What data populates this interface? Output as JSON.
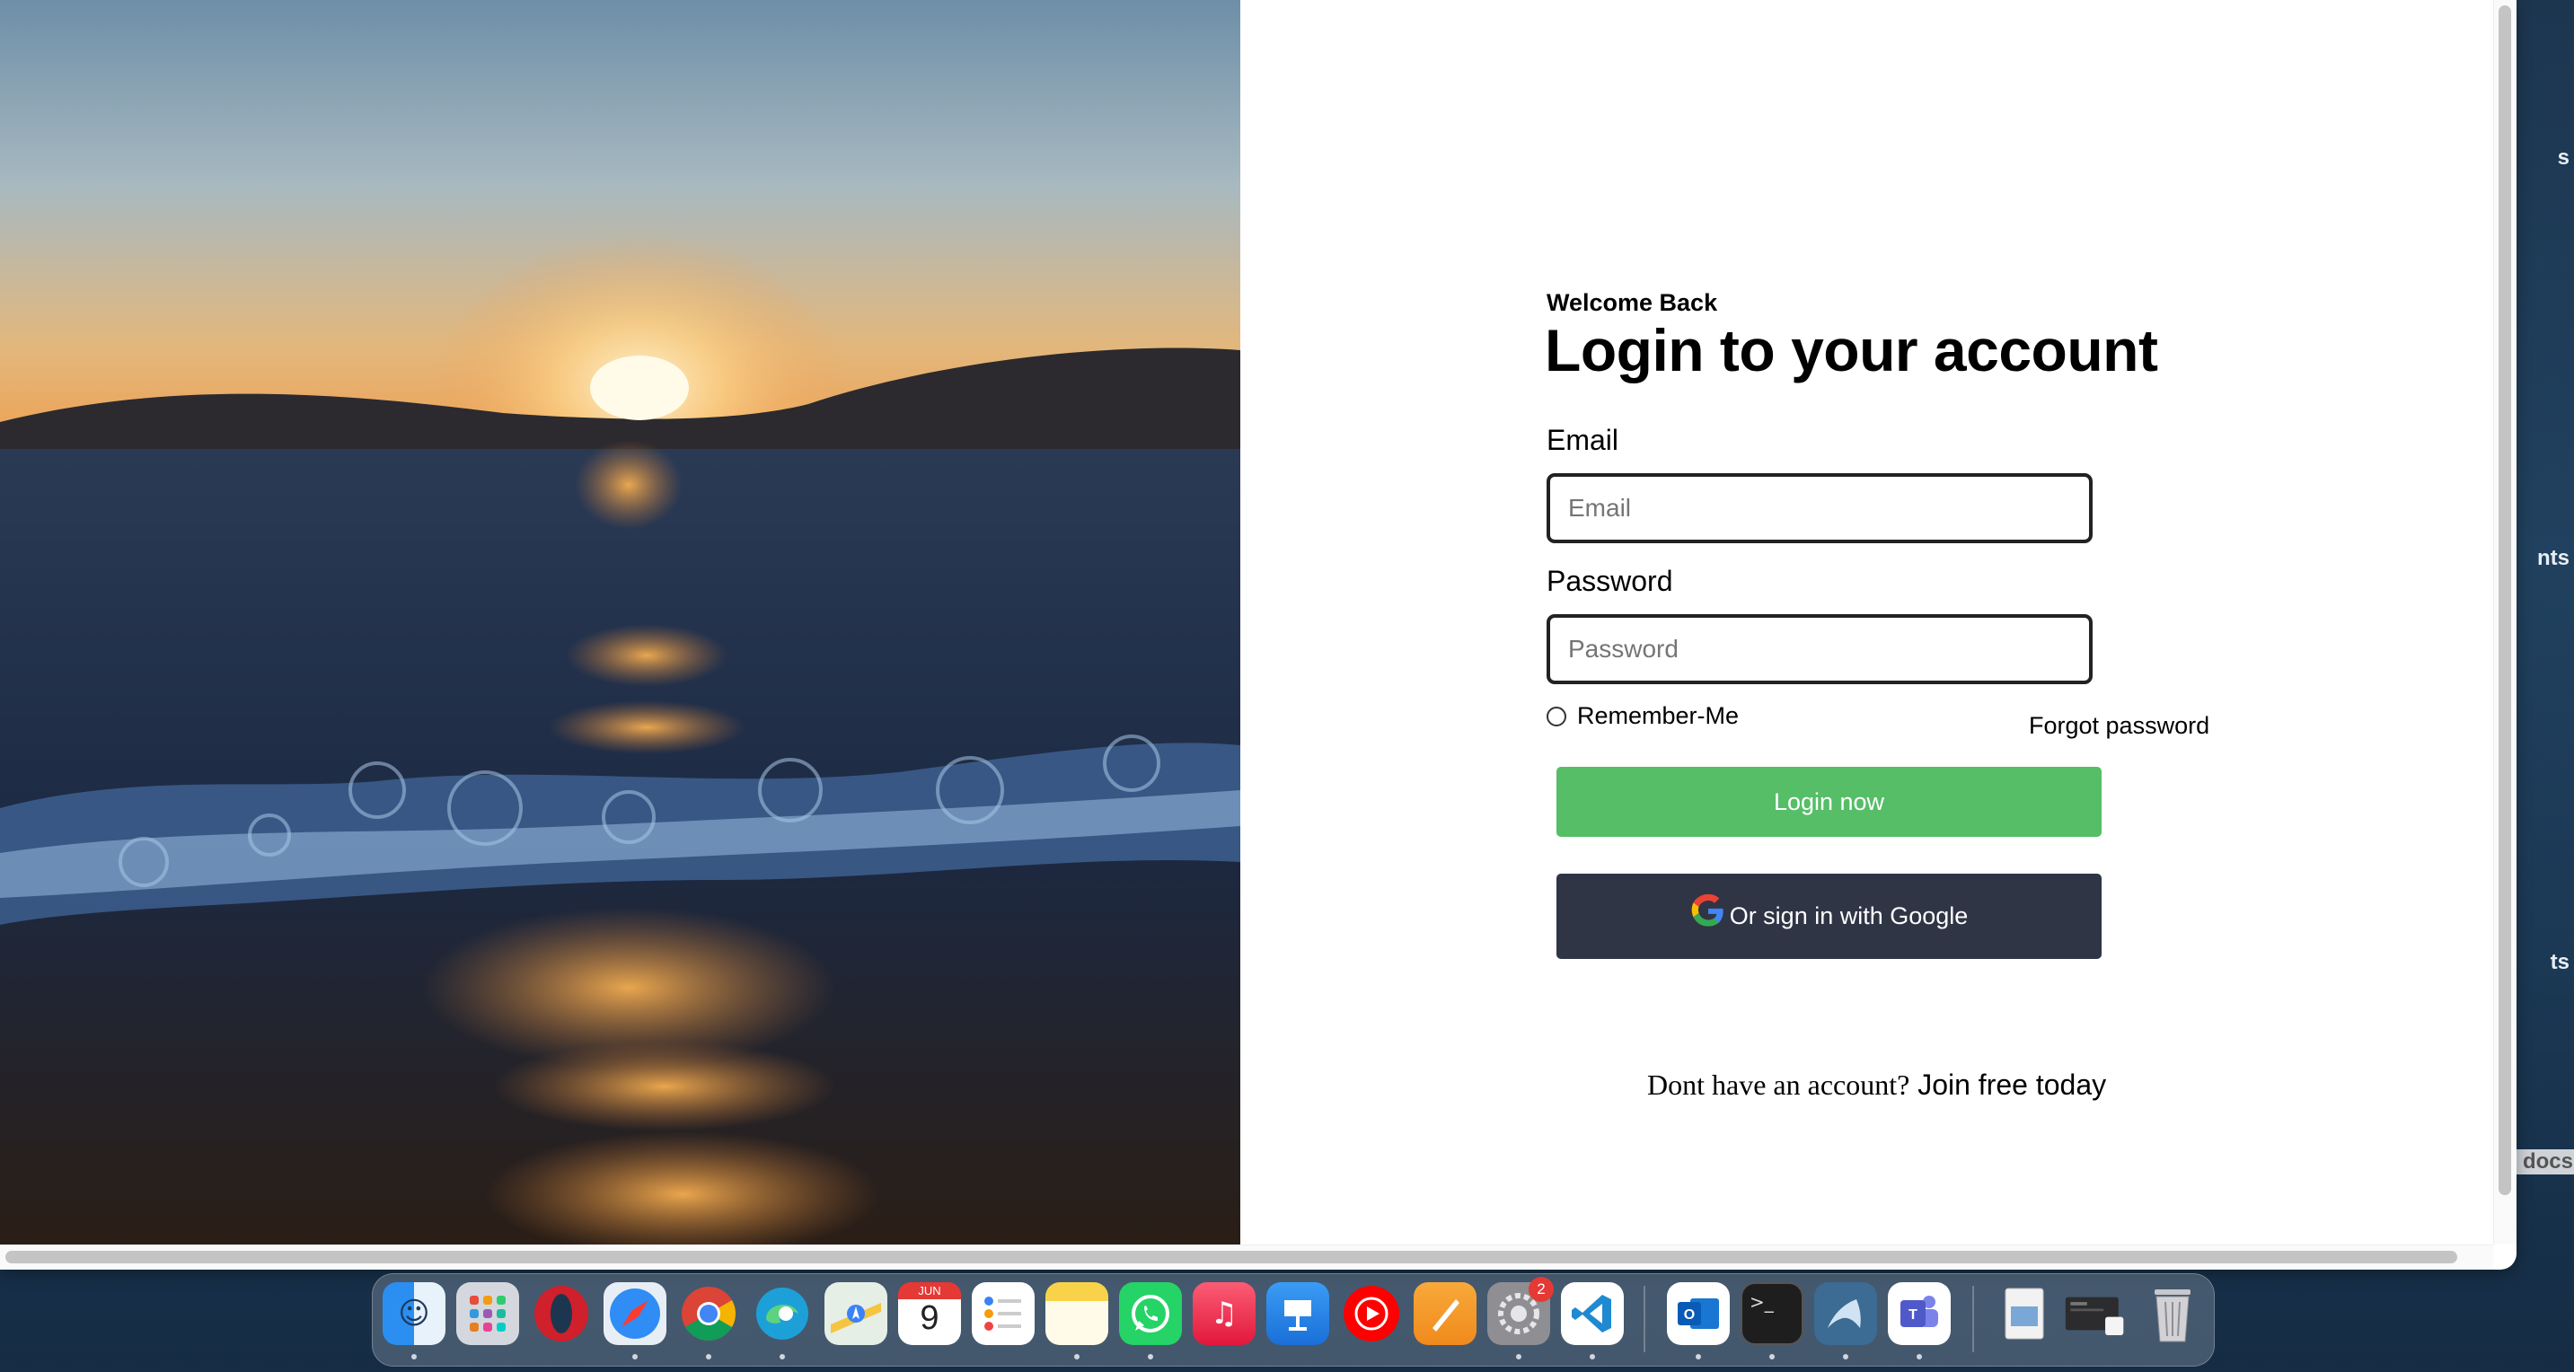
{
  "login": {
    "welcome": "Welcome Back",
    "title": "Login to your account",
    "email_label": "Email",
    "email_placeholder": "Email",
    "password_label": "Password",
    "password_placeholder": "Password",
    "remember_label": "Remember-Me",
    "forgot_label": "Forgot password",
    "login_button": "Login now",
    "google_button": "Or sign in with Google",
    "signup_question": "Dont have an account?",
    "signup_link": "Join free today"
  },
  "desktop": {
    "labels": [
      "s",
      "nts",
      "ts",
      "docs"
    ]
  },
  "dock": {
    "calendar_month": "JUN",
    "calendar_day": "9",
    "settings_badge": "2",
    "icons": [
      "finder-icon",
      "launchpad-icon",
      "opera-icon",
      "safari-icon",
      "chrome-icon",
      "edge-icon",
      "maps-icon",
      "calendar-icon",
      "reminders-icon",
      "notes-icon",
      "whatsapp-icon",
      "music-icon",
      "keynote-icon",
      "youtube-music-icon",
      "pages-icon",
      "system-settings-icon",
      "vscode-icon",
      "outlook-icon",
      "terminal-icon",
      "mysql-workbench-icon",
      "teams-icon",
      "preview-icon",
      "desktop-folder-icon",
      "trash-icon"
    ]
  },
  "colors": {
    "login_button": "#55be67",
    "google_button": "#2f3545"
  }
}
